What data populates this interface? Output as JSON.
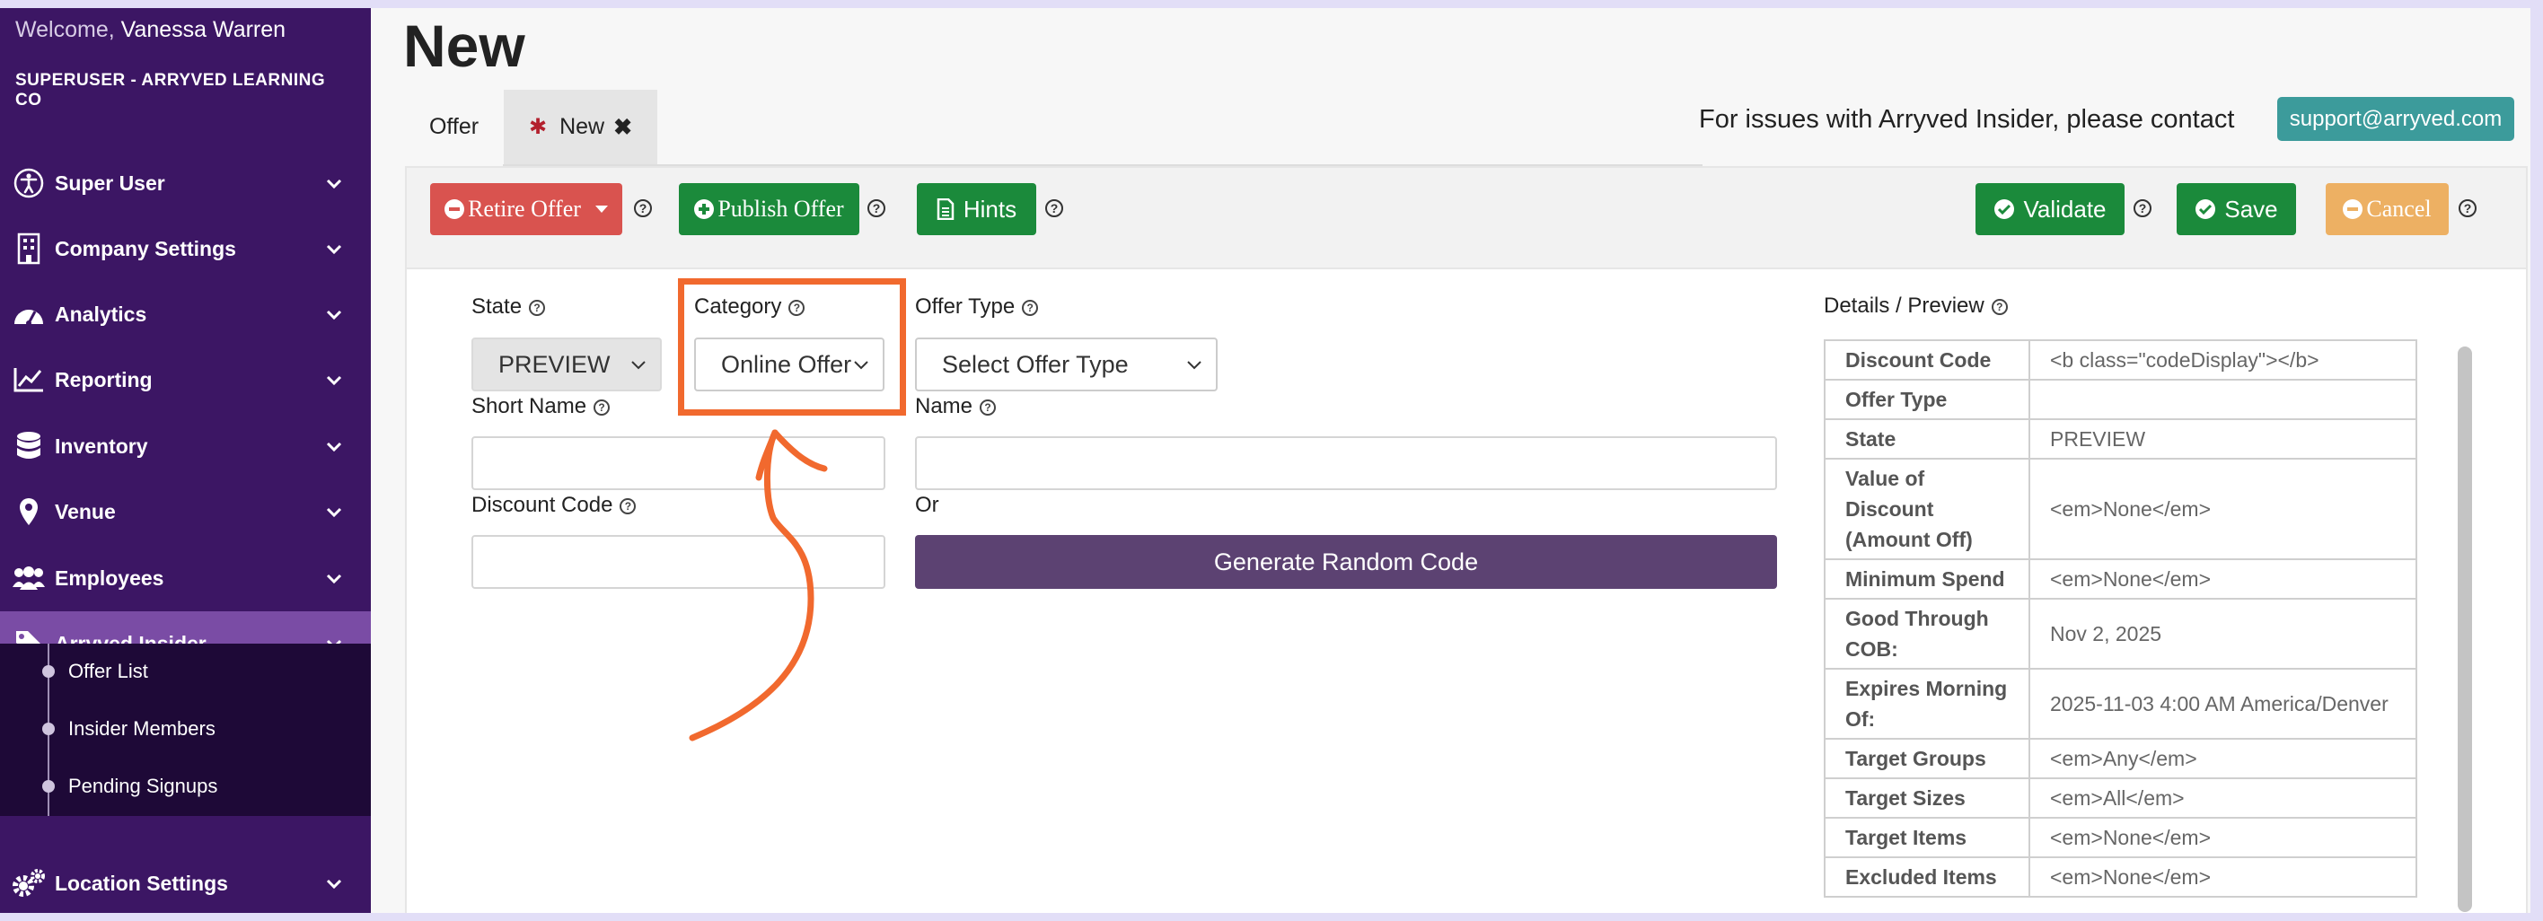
{
  "sidebar": {
    "welcome_prefix": "Welcome,",
    "user_name": "Vanessa Warren",
    "company": "SUPERUSER - ARRYVED LEARNING CO",
    "items": [
      {
        "label": "Super User",
        "icon": "accessibility-icon"
      },
      {
        "label": "Company Settings",
        "icon": "building-icon"
      },
      {
        "label": "Analytics",
        "icon": "dashboard-icon"
      },
      {
        "label": "Reporting",
        "icon": "line-chart-icon"
      },
      {
        "label": "Inventory",
        "icon": "database-icon"
      },
      {
        "label": "Venue",
        "icon": "map-marker-icon"
      },
      {
        "label": "Employees",
        "icon": "users-icon"
      },
      {
        "label": "Arryved Insider",
        "icon": "tag-icon"
      },
      {
        "label": "Location Settings",
        "icon": "cogs-icon"
      }
    ],
    "subitems": [
      {
        "label": "Offer List"
      },
      {
        "label": "Insider Members"
      },
      {
        "label": "Pending Signups"
      }
    ]
  },
  "page": {
    "title": "New"
  },
  "tabs": {
    "offer": "Offer",
    "new": "New"
  },
  "support": {
    "text": "For issues with Arryved Insider, please contact",
    "email": "support@arryved.com"
  },
  "toolbar": {
    "retire": "Retire Offer",
    "publish": "Publish Offer",
    "hints": "Hints",
    "validate": "Validate",
    "save": "Save",
    "cancel": "Cancel"
  },
  "form": {
    "state_label": "State",
    "state_value": "PREVIEW",
    "category_label": "Category",
    "category_value": "Online Offer",
    "offer_type_label": "Offer Type",
    "offer_type_placeholder": "Select Offer Type",
    "short_name_label": "Short Name",
    "short_name_value": "",
    "name_label": "Name",
    "name_value": "",
    "discount_code_label": "Discount Code",
    "discount_code_value": "",
    "or_label": "Or",
    "generate_button": "Generate Random Code"
  },
  "preview": {
    "title": "Details / Preview",
    "rows": [
      {
        "key": "Discount Code",
        "value": "<b class=\"codeDisplay\"></b>"
      },
      {
        "key": "Offer Type",
        "value": ""
      },
      {
        "key": "State",
        "value": "PREVIEW"
      },
      {
        "key": "Value of Discount (Amount Off)",
        "value": "<em>None</em>"
      },
      {
        "key": "Minimum Spend",
        "value": "<em>None</em>"
      },
      {
        "key": "Good Through COB:",
        "value": "Nov 2, 2025"
      },
      {
        "key": "Expires Morning Of:",
        "value": "2025-11-03 4:00 AM America/Denver"
      },
      {
        "key": "Target Groups",
        "value": "<em>Any</em>"
      },
      {
        "key": "Target Sizes",
        "value": "<em>All</em>"
      },
      {
        "key": "Target Items",
        "value": "<em>None</em>"
      },
      {
        "key": "Excluded Items",
        "value": "<em>None</em>"
      }
    ]
  },
  "colors": {
    "sidebar_bg": "#3c1664",
    "sidebar_active": "#7a4ca5",
    "retire_red": "#d9534f",
    "action_green": "#1b8a3b",
    "cancel_orange": "#edb063",
    "support_teal": "#3c9b9b",
    "generate_purple": "#5c4272",
    "highlight_orange": "#f1692e"
  }
}
